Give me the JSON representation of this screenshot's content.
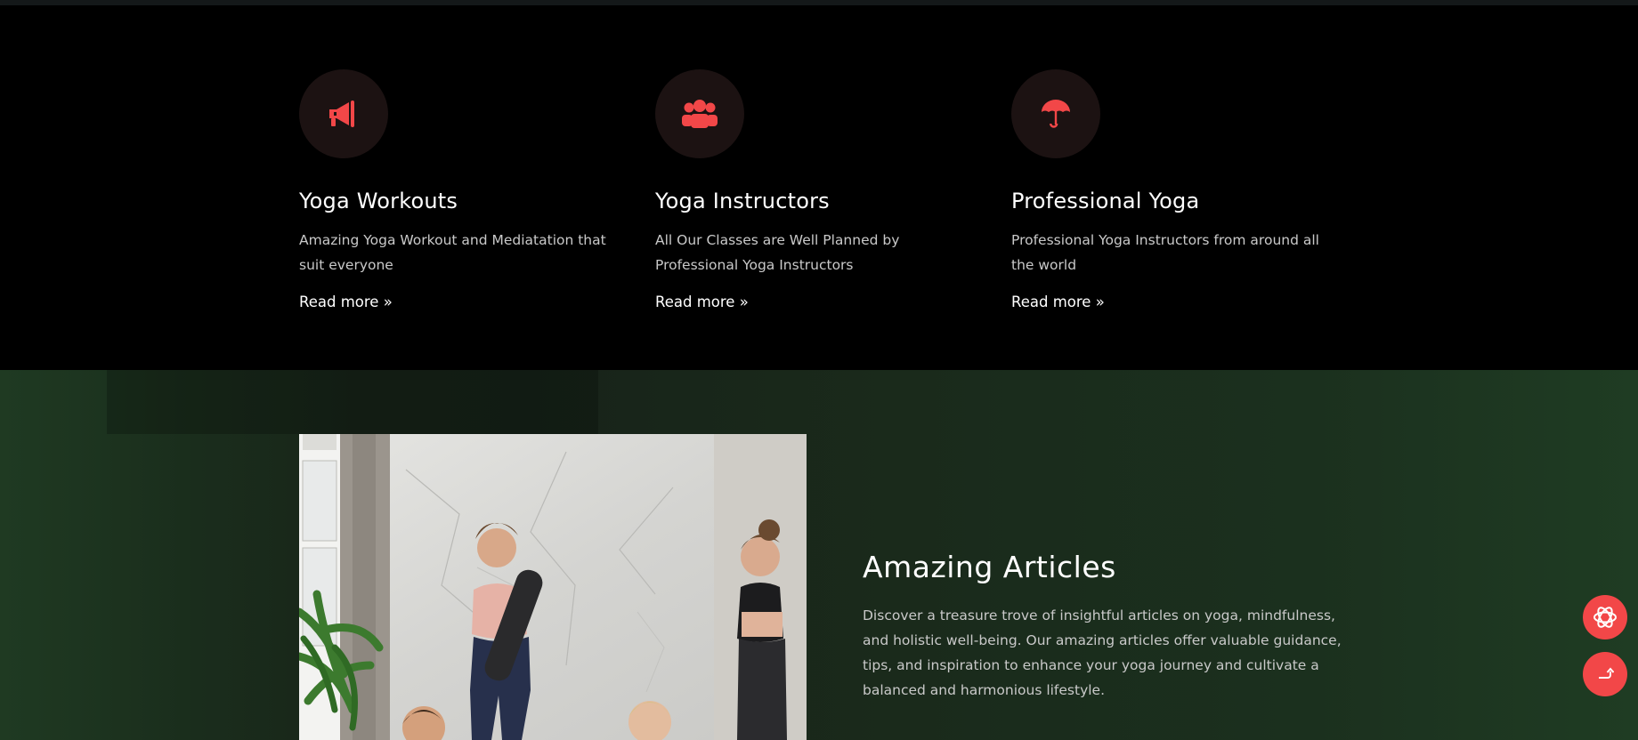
{
  "features": [
    {
      "icon": "megaphone-icon",
      "title": "Yoga Workouts",
      "description": "Amazing Yoga Workout and Mediatation that suit everyone",
      "link": "Read more »"
    },
    {
      "icon": "users-icon",
      "title": "Yoga Instructors",
      "description": "All Our Classes are Well Planned by Professional Yoga Instructors",
      "link": "Read more »"
    },
    {
      "icon": "umbrella-icon",
      "title": "Professional Yoga",
      "description": "Professional Yoga Instructors from around all the world",
      "link": "Read more »"
    }
  ],
  "articles": {
    "title": "Amazing Articles",
    "description": "Discover a treasure trove of insightful articles on yoga, mindfulness, and holistic well-being. Our amazing articles offer valuable guidance, tips, and inspiration to enhance your yoga journey and cultivate a balanced and harmonious lifestyle.",
    "image": "yoga-class-photo"
  },
  "floating_buttons": [
    {
      "icon": "openai-icon"
    },
    {
      "icon": "share-arrow-icon"
    }
  ],
  "colors": {
    "accent": "#f24748",
    "background": "#000000",
    "articles_bg": "#1b2d1d",
    "text_muted": "#c9c9c9"
  }
}
